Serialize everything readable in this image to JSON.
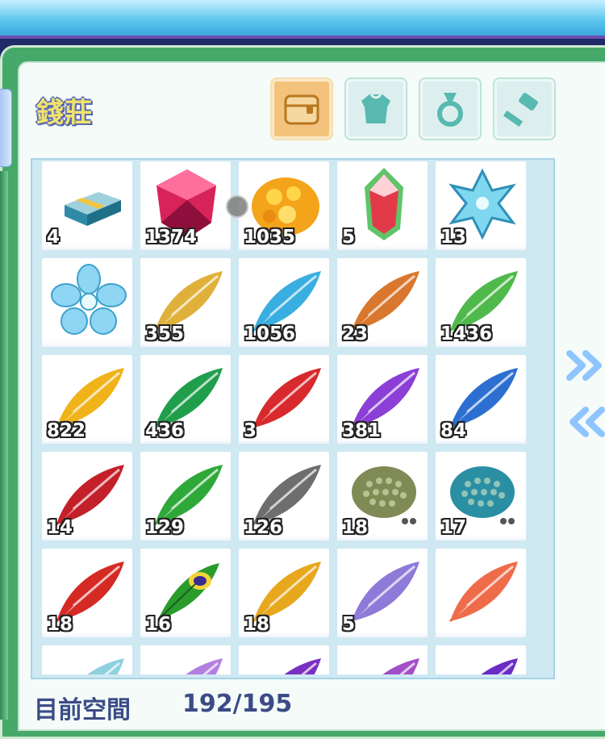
{
  "window": {
    "title": "錢莊"
  },
  "tabs": [
    {
      "name": "tab-treasure-chest",
      "icon": "treasure-chest-icon",
      "active": true
    },
    {
      "name": "tab-armor",
      "icon": "armor-icon",
      "active": false
    },
    {
      "name": "tab-ring",
      "icon": "ring-icon",
      "active": false
    },
    {
      "name": "tab-weapon",
      "icon": "hammer-icon",
      "active": false
    }
  ],
  "items": [
    {
      "icon": "book-icon",
      "qty": "4",
      "color": "#2f8aa8"
    },
    {
      "icon": "red-gem-icon",
      "qty": "1374",
      "color": "#d8235a"
    },
    {
      "icon": "gold-ore-icon",
      "qty": "1035",
      "color": "#f3a41a"
    },
    {
      "icon": "rainbow-crystal-icon",
      "qty": "5",
      "color": "#e33a4a"
    },
    {
      "icon": "ice-crystal-icon",
      "qty": "13",
      "color": "#7fd7f0"
    },
    {
      "icon": "ice-flower-icon",
      "qty": "",
      "color": "#8fd6f4"
    },
    {
      "icon": "feather-icon",
      "qty": "355",
      "color": "#e0b13a"
    },
    {
      "icon": "feather-icon",
      "qty": "1056",
      "color": "#39aee0"
    },
    {
      "icon": "feather-icon",
      "qty": "23",
      "color": "#d8772d"
    },
    {
      "icon": "feather-icon",
      "qty": "1436",
      "color": "#4fb94b"
    },
    {
      "icon": "feather-icon",
      "qty": "822",
      "color": "#f0b319"
    },
    {
      "icon": "feather-icon",
      "qty": "436",
      "color": "#1f9f4c"
    },
    {
      "icon": "feather-icon",
      "qty": "3",
      "color": "#d8292c"
    },
    {
      "icon": "feather-icon",
      "qty": "381",
      "color": "#8b3fd6"
    },
    {
      "icon": "feather-icon",
      "qty": "84",
      "color": "#2c6fd1"
    },
    {
      "icon": "feather-icon",
      "qty": "14",
      "color": "#c4202a"
    },
    {
      "icon": "feather-icon",
      "qty": "129",
      "color": "#2fa83a"
    },
    {
      "icon": "feather-icon",
      "qty": "126",
      "color": "#6e6e6e"
    },
    {
      "icon": "scale-cluster-icon",
      "qty": "18",
      "color": "#7f8a55"
    },
    {
      "icon": "scale-cluster-icon",
      "qty": "17",
      "color": "#2b8fa3"
    },
    {
      "icon": "feather-icon",
      "qty": "18",
      "color": "#d52a24"
    },
    {
      "icon": "peacock-feather-icon",
      "qty": "16",
      "color": "#2a9c2c"
    },
    {
      "icon": "feather-icon",
      "qty": "18",
      "color": "#e8a81e"
    },
    {
      "icon": "feather-icon",
      "qty": "5",
      "color": "#8e7ad8"
    },
    {
      "icon": "feather-icon",
      "qty": "",
      "color": "#ef6c4a"
    },
    {
      "icon": "feather-icon",
      "qty": "",
      "color": "#8fd0e0"
    },
    {
      "icon": "feather-icon",
      "qty": "",
      "color": "#b27fe0"
    },
    {
      "icon": "feather-icon",
      "qty": "",
      "color": "#7a2fc0"
    },
    {
      "icon": "feather-icon",
      "qty": "",
      "color": "#a34fc8"
    },
    {
      "icon": "feather-icon",
      "qty": "",
      "color": "#6a2cc4"
    }
  ],
  "footer": {
    "space_label": "目前空間",
    "space_value": "192/195"
  },
  "nav": {
    "next_icon": "double-chevron-right-icon",
    "prev_icon": "double-chevron-left-icon"
  }
}
